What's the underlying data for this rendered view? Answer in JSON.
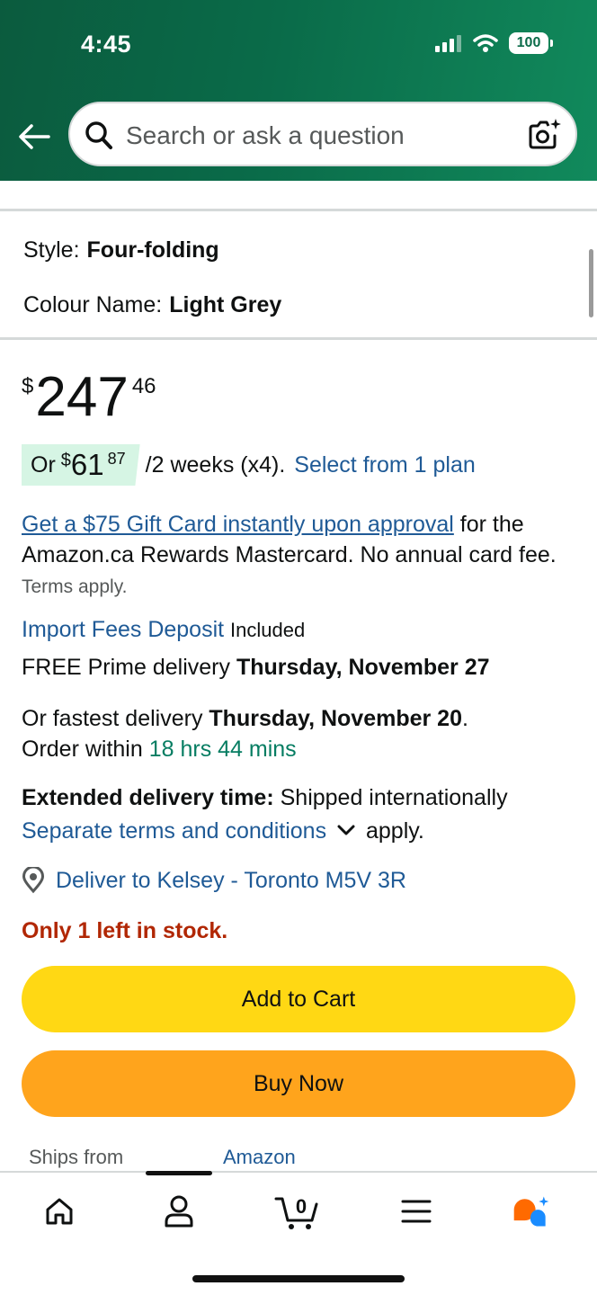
{
  "status_bar": {
    "time": "4:45",
    "battery": "100"
  },
  "search": {
    "placeholder": "Search or ask a question"
  },
  "variations": {
    "style_label": "Style:",
    "style_value": "Four-folding",
    "colour_label": "Colour Name:",
    "colour_value": "Light Grey"
  },
  "price": {
    "symbol": "$",
    "whole": "247",
    "fraction": "46"
  },
  "installments": {
    "or": "Or",
    "symbol": "$",
    "whole": "61",
    "fraction": "87",
    "period": "/2 weeks (x4).",
    "plan_link": "Select from 1 plan"
  },
  "card_offer": {
    "link": "Get a $75 Gift Card instantly upon approval",
    "text": "for the Amazon.ca Rewards Mastercard. No annual card fee.",
    "terms": "Terms apply."
  },
  "import_fees": {
    "link": "Import Fees Deposit",
    "status": "Included"
  },
  "delivery": {
    "free_prefix": "FREE Prime delivery",
    "free_date": "Thursday, November 27",
    "fastest_prefix": "Or fastest delivery",
    "fastest_date": "Thursday, November 20",
    "order_within": "Order within",
    "countdown": "18 hrs 44 mins"
  },
  "extended": {
    "label": "Extended delivery time:",
    "text": "Shipped internationally",
    "terms_link": "Separate terms and conditions",
    "apply": "apply."
  },
  "deliver_to": "Deliver to Kelsey - Toronto M5V 3R",
  "stock": "Only 1 left in stock.",
  "buttons": {
    "add_to_cart": "Add to Cart",
    "buy_now": "Buy Now"
  },
  "ships_from": {
    "label": "Ships from",
    "value": "Amazon"
  },
  "nav": {
    "cart_count": "0",
    "icons": [
      "home-icon",
      "account-icon",
      "cart-icon",
      "menu-icon",
      "rufus-assistant-icon"
    ]
  },
  "colors": {
    "header": "#0a6b49",
    "link": "#1f5a96",
    "add_to_cart": "#ffd814",
    "buy_now": "#ffa41c",
    "stock_red": "#b12704",
    "green": "#067d62"
  }
}
